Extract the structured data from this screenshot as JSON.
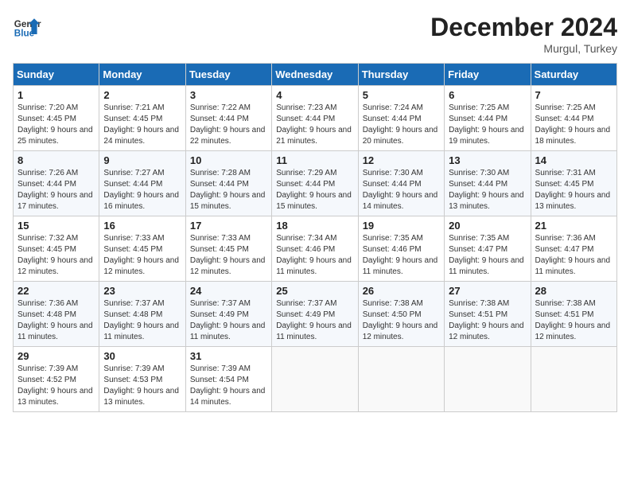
{
  "header": {
    "logo_general": "General",
    "logo_blue": "Blue",
    "month_title": "December 2024",
    "location": "Murgul, Turkey"
  },
  "days_of_week": [
    "Sunday",
    "Monday",
    "Tuesday",
    "Wednesday",
    "Thursday",
    "Friday",
    "Saturday"
  ],
  "weeks": [
    [
      {
        "day": "1",
        "sunrise": "Sunrise: 7:20 AM",
        "sunset": "Sunset: 4:45 PM",
        "daylight": "Daylight: 9 hours and 25 minutes."
      },
      {
        "day": "2",
        "sunrise": "Sunrise: 7:21 AM",
        "sunset": "Sunset: 4:45 PM",
        "daylight": "Daylight: 9 hours and 24 minutes."
      },
      {
        "day": "3",
        "sunrise": "Sunrise: 7:22 AM",
        "sunset": "Sunset: 4:44 PM",
        "daylight": "Daylight: 9 hours and 22 minutes."
      },
      {
        "day": "4",
        "sunrise": "Sunrise: 7:23 AM",
        "sunset": "Sunset: 4:44 PM",
        "daylight": "Daylight: 9 hours and 21 minutes."
      },
      {
        "day": "5",
        "sunrise": "Sunrise: 7:24 AM",
        "sunset": "Sunset: 4:44 PM",
        "daylight": "Daylight: 9 hours and 20 minutes."
      },
      {
        "day": "6",
        "sunrise": "Sunrise: 7:25 AM",
        "sunset": "Sunset: 4:44 PM",
        "daylight": "Daylight: 9 hours and 19 minutes."
      },
      {
        "day": "7",
        "sunrise": "Sunrise: 7:25 AM",
        "sunset": "Sunset: 4:44 PM",
        "daylight": "Daylight: 9 hours and 18 minutes."
      }
    ],
    [
      {
        "day": "8",
        "sunrise": "Sunrise: 7:26 AM",
        "sunset": "Sunset: 4:44 PM",
        "daylight": "Daylight: 9 hours and 17 minutes."
      },
      {
        "day": "9",
        "sunrise": "Sunrise: 7:27 AM",
        "sunset": "Sunset: 4:44 PM",
        "daylight": "Daylight: 9 hours and 16 minutes."
      },
      {
        "day": "10",
        "sunrise": "Sunrise: 7:28 AM",
        "sunset": "Sunset: 4:44 PM",
        "daylight": "Daylight: 9 hours and 15 minutes."
      },
      {
        "day": "11",
        "sunrise": "Sunrise: 7:29 AM",
        "sunset": "Sunset: 4:44 PM",
        "daylight": "Daylight: 9 hours and 15 minutes."
      },
      {
        "day": "12",
        "sunrise": "Sunrise: 7:30 AM",
        "sunset": "Sunset: 4:44 PM",
        "daylight": "Daylight: 9 hours and 14 minutes."
      },
      {
        "day": "13",
        "sunrise": "Sunrise: 7:30 AM",
        "sunset": "Sunset: 4:44 PM",
        "daylight": "Daylight: 9 hours and 13 minutes."
      },
      {
        "day": "14",
        "sunrise": "Sunrise: 7:31 AM",
        "sunset": "Sunset: 4:45 PM",
        "daylight": "Daylight: 9 hours and 13 minutes."
      }
    ],
    [
      {
        "day": "15",
        "sunrise": "Sunrise: 7:32 AM",
        "sunset": "Sunset: 4:45 PM",
        "daylight": "Daylight: 9 hours and 12 minutes."
      },
      {
        "day": "16",
        "sunrise": "Sunrise: 7:33 AM",
        "sunset": "Sunset: 4:45 PM",
        "daylight": "Daylight: 9 hours and 12 minutes."
      },
      {
        "day": "17",
        "sunrise": "Sunrise: 7:33 AM",
        "sunset": "Sunset: 4:45 PM",
        "daylight": "Daylight: 9 hours and 12 minutes."
      },
      {
        "day": "18",
        "sunrise": "Sunrise: 7:34 AM",
        "sunset": "Sunset: 4:46 PM",
        "daylight": "Daylight: 9 hours and 11 minutes."
      },
      {
        "day": "19",
        "sunrise": "Sunrise: 7:35 AM",
        "sunset": "Sunset: 4:46 PM",
        "daylight": "Daylight: 9 hours and 11 minutes."
      },
      {
        "day": "20",
        "sunrise": "Sunrise: 7:35 AM",
        "sunset": "Sunset: 4:47 PM",
        "daylight": "Daylight: 9 hours and 11 minutes."
      },
      {
        "day": "21",
        "sunrise": "Sunrise: 7:36 AM",
        "sunset": "Sunset: 4:47 PM",
        "daylight": "Daylight: 9 hours and 11 minutes."
      }
    ],
    [
      {
        "day": "22",
        "sunrise": "Sunrise: 7:36 AM",
        "sunset": "Sunset: 4:48 PM",
        "daylight": "Daylight: 9 hours and 11 minutes."
      },
      {
        "day": "23",
        "sunrise": "Sunrise: 7:37 AM",
        "sunset": "Sunset: 4:48 PM",
        "daylight": "Daylight: 9 hours and 11 minutes."
      },
      {
        "day": "24",
        "sunrise": "Sunrise: 7:37 AM",
        "sunset": "Sunset: 4:49 PM",
        "daylight": "Daylight: 9 hours and 11 minutes."
      },
      {
        "day": "25",
        "sunrise": "Sunrise: 7:37 AM",
        "sunset": "Sunset: 4:49 PM",
        "daylight": "Daylight: 9 hours and 11 minutes."
      },
      {
        "day": "26",
        "sunrise": "Sunrise: 7:38 AM",
        "sunset": "Sunset: 4:50 PM",
        "daylight": "Daylight: 9 hours and 12 minutes."
      },
      {
        "day": "27",
        "sunrise": "Sunrise: 7:38 AM",
        "sunset": "Sunset: 4:51 PM",
        "daylight": "Daylight: 9 hours and 12 minutes."
      },
      {
        "day": "28",
        "sunrise": "Sunrise: 7:38 AM",
        "sunset": "Sunset: 4:51 PM",
        "daylight": "Daylight: 9 hours and 12 minutes."
      }
    ],
    [
      {
        "day": "29",
        "sunrise": "Sunrise: 7:39 AM",
        "sunset": "Sunset: 4:52 PM",
        "daylight": "Daylight: 9 hours and 13 minutes."
      },
      {
        "day": "30",
        "sunrise": "Sunrise: 7:39 AM",
        "sunset": "Sunset: 4:53 PM",
        "daylight": "Daylight: 9 hours and 13 minutes."
      },
      {
        "day": "31",
        "sunrise": "Sunrise: 7:39 AM",
        "sunset": "Sunset: 4:54 PM",
        "daylight": "Daylight: 9 hours and 14 minutes."
      },
      null,
      null,
      null,
      null
    ]
  ]
}
